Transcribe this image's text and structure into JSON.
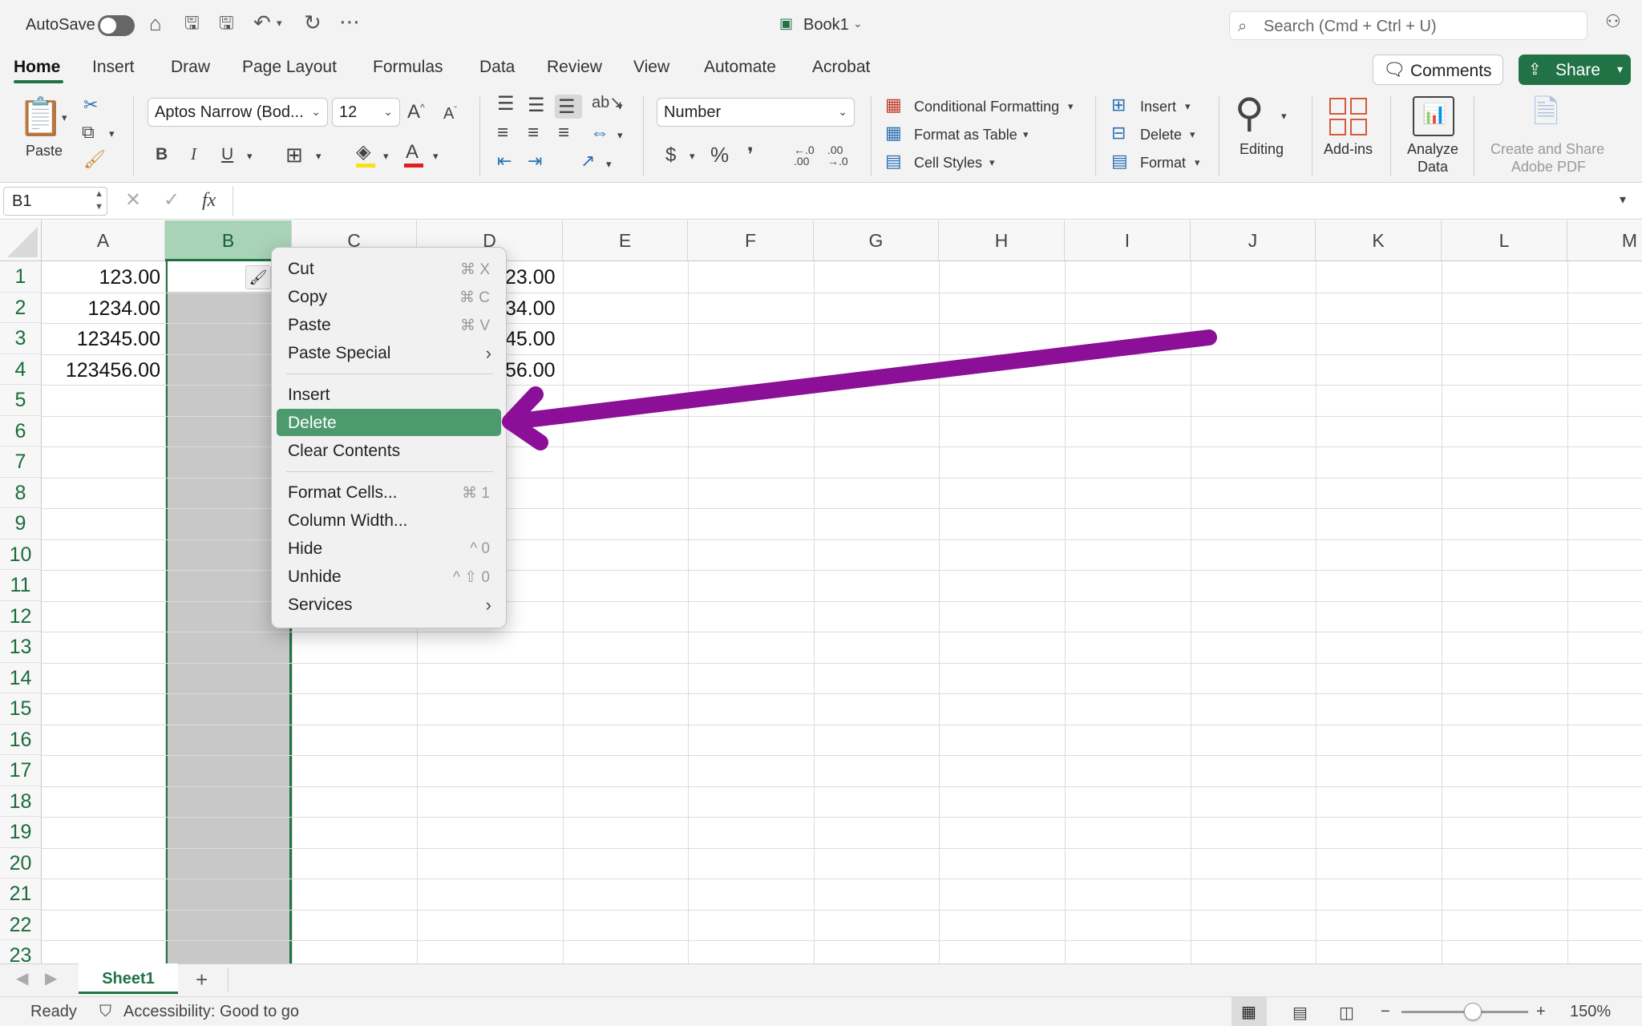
{
  "titlebar": {
    "autosave_label": "AutoSave",
    "doc_title": "Book1",
    "search_placeholder": "Search (Cmd + Ctrl + U)",
    "icons": [
      "home-icon",
      "save-icon",
      "save-as-icon",
      "undo-icon",
      "redo-icon",
      "more-icon",
      "people-icon"
    ]
  },
  "tabs": [
    "Home",
    "Insert",
    "Draw",
    "Page Layout",
    "Formulas",
    "Data",
    "Review",
    "View",
    "Automate",
    "Acrobat"
  ],
  "active_tab": "Home",
  "header_buttons": {
    "comments": "Comments",
    "share": "Share"
  },
  "ribbon": {
    "paste": "Paste",
    "font_name": "Aptos Narrow (Bod...",
    "font_size": "12",
    "bold": "B",
    "italic": "I",
    "underline": "U",
    "number_format": "Number",
    "currency": "$",
    "percent": "%",
    "comma": "❜",
    "dec_increase": "←.0\n.00",
    "dec_decrease": ".00\n→.0",
    "conditional_formatting": "Conditional Formatting",
    "format_as_table": "Format as Table",
    "cell_styles": "Cell Styles",
    "insert": "Insert",
    "delete": "Delete",
    "format": "Format",
    "editing": "Editing",
    "addins": "Add-ins",
    "analyze_data_1": "Analyze",
    "analyze_data_2": "Data",
    "create_share_1": "Create and Share",
    "create_share_2": "Adobe PDF"
  },
  "formula_bar": {
    "name_box": "B1",
    "fx": "fx"
  },
  "grid": {
    "columns": [
      "A",
      "B",
      "C",
      "D",
      "E",
      "F",
      "G",
      "H",
      "I",
      "J",
      "K",
      "L",
      "M"
    ],
    "selected_column": "B",
    "rows": [
      "1",
      "2",
      "3",
      "4",
      "5",
      "6",
      "7",
      "8",
      "9",
      "10",
      "11",
      "12",
      "13",
      "14",
      "15",
      "16",
      "17",
      "18",
      "19",
      "20",
      "21",
      "22",
      "23"
    ],
    "col_a": [
      "123.00",
      "1234.00",
      "12345.00",
      "123456.00"
    ],
    "col_d_visible": [
      "23.00",
      "34.00",
      "45.00",
      "56.00"
    ]
  },
  "context_menu": {
    "items": [
      {
        "label": "Cut",
        "shortcut": "⌘ X"
      },
      {
        "label": "Copy",
        "shortcut": "⌘ C"
      },
      {
        "label": "Paste",
        "shortcut": "⌘ V"
      },
      {
        "label": "Paste Special",
        "submenu": true
      },
      {
        "label": "Insert"
      },
      {
        "label": "Delete",
        "highlighted": true
      },
      {
        "label": "Clear Contents"
      },
      {
        "label": "Format Cells...",
        "shortcut": "⌘ 1"
      },
      {
        "label": "Column Width..."
      },
      {
        "label": "Hide",
        "shortcut": "^ 0"
      },
      {
        "label": "Unhide",
        "shortcut": "^ ⇧ 0"
      },
      {
        "label": "Services",
        "submenu": true
      }
    ]
  },
  "sheets": {
    "active": "Sheet1",
    "add": "+"
  },
  "status": {
    "ready": "Ready",
    "accessibility": "Accessibility: Good to go",
    "zoom": "150%"
  },
  "colors": {
    "accent": "#217346",
    "selection": "#c8c8c8",
    "menu_highlight": "#4e9a6f",
    "arrow": "#8b0f97"
  }
}
